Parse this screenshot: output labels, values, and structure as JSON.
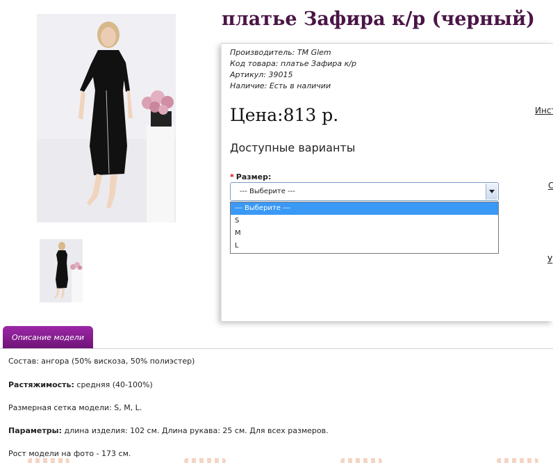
{
  "product": {
    "title": "платье Зафира к/р (черный)",
    "meta": [
      {
        "key": "Производитель:",
        "value": "TM Glem"
      },
      {
        "key": "Код товара:",
        "value": "платье Зафира к/р"
      },
      {
        "key": "Артикул:",
        "value": "39015"
      },
      {
        "key": "Наличие:",
        "value": "Есть в наличии"
      }
    ],
    "price": "Цена:813 р.",
    "variants_title": "Доступные варианты",
    "size_label": "Размер:",
    "size_select": {
      "value": "--- Выберите ---",
      "options": [
        "--- Выберите ---",
        "S",
        "M",
        "L"
      ]
    }
  },
  "right_links": {
    "link1": "Инст",
    "link2": "С",
    "link3": "У"
  },
  "tabs": {
    "description": "Описание модели"
  },
  "description": {
    "composition": {
      "label": "Состав:",
      "value": "ангора (50% вискоза, 50% полиэстер)"
    },
    "stretch": {
      "label": "Растяжимость:",
      "value": "средняя (40-100%)"
    },
    "sizes": {
      "label": "Размерная сетка модели:",
      "value": "S, M, L."
    },
    "params": {
      "label": "Параметры:",
      "value": "длина изделия: 102 см. Длина рукава: 25 см. Для всех размеров."
    },
    "height": "Рост модели на фото - 173 см."
  },
  "colors": {
    "title": "#4a1646",
    "tab": "#8b1d94",
    "highlight": "#3b99f6"
  }
}
